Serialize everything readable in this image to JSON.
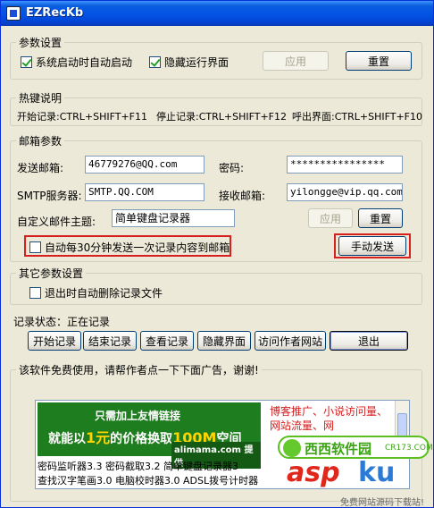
{
  "window": {
    "title": "EZRecKb"
  },
  "params": {
    "legend": "参数设置",
    "auto_start": {
      "label": "系统启动时自动启动",
      "checked": true
    },
    "hide_ui": {
      "label": "隐藏运行界面",
      "checked": true
    },
    "apply_label": "应用",
    "reset_label": "重置"
  },
  "hotkeys": {
    "legend": "热键说明",
    "start": "开始记录:CTRL+SHIFT+F11",
    "stop": "停止记录:CTRL+SHIFT+F12",
    "show": "呼出界面:CTRL+SHIFT+F10"
  },
  "email": {
    "legend": "邮箱参数",
    "sender_label": "发送邮箱:",
    "sender_value": "46779276@QQ.com",
    "password_label": "密码:",
    "password_value": "****************",
    "smtp_label": "SMTP服务器:",
    "smtp_value": "SMTP.QQ.COM",
    "receiver_label": "接收邮箱:",
    "receiver_value": "yilongge@vip.qq.com",
    "subject_label": "自定义邮件主题:",
    "subject_value": "简单键盘记录器",
    "apply_label": "应用",
    "reset_label": "重置",
    "auto_send": {
      "label": "自动每30分钟发送一次记录内容到邮箱",
      "checked": false
    },
    "manual_send_label": "手动发送"
  },
  "other": {
    "legend": "其它参数设置",
    "delete_on_exit": {
      "label": "退出时自动删除记录文件",
      "checked": false
    }
  },
  "status": {
    "text": "记录状态：正在记录"
  },
  "actions": {
    "start": "开始记录",
    "stop": "结束记录",
    "view": "查看记录",
    "hide": "隐藏界面",
    "visit": "访问作者网站",
    "exit": "退出"
  },
  "ad": {
    "legend": "该软件免费使用，请帮作者点一下下面广告，谢谢!",
    "banner_line1": "只需加上友情链接",
    "banner_line2_pre": "就能以",
    "banner_line2_hl": "1元",
    "banner_line2_mid": "的价格换取",
    "banner_line2_hl2": "100M",
    "banner_line2_post": "空间",
    "banner_brand": "alimama.com 提供",
    "right_text": "博客推广、小说访问量、网站流量、网",
    "list_line1": "密码监听器3.3  密码截取3.2  简单键盘记录器3",
    "list_line2": "查找汉字笔画3.0  电脑校时器3.0  ADSL拨号计时器"
  },
  "watermark": {
    "top": "西西软件园",
    "top_small": "CR173.COM",
    "asp": "asp",
    "ku": "ku",
    "sub": "免费网站源码下载站!"
  }
}
